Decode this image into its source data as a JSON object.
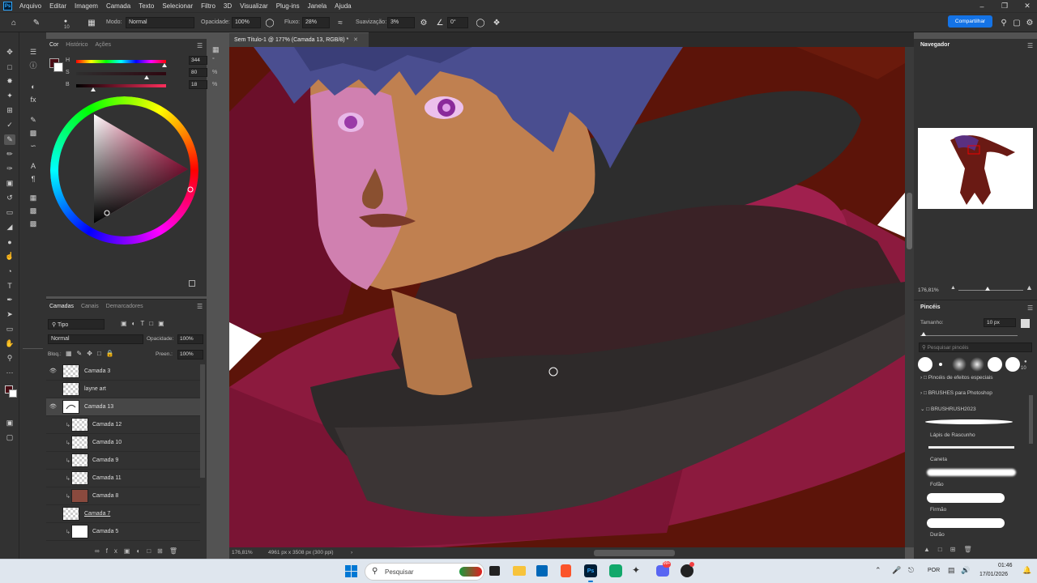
{
  "menu": [
    "Arquivo",
    "Editar",
    "Imagem",
    "Camada",
    "Texto",
    "Selecionar",
    "Filtro",
    "3D",
    "Visualizar",
    "Plug-ins",
    "Janela",
    "Ajuda"
  ],
  "options": {
    "brush_size": "10",
    "mode_label": "Modo:",
    "mode_value": "Normal",
    "opacity_label": "Opacidade:",
    "opacity_value": "100%",
    "flow_label": "Fluxo:",
    "flow_value": "28%",
    "smoothing_label": "Suavização:",
    "smoothing_value": "3%",
    "angle_value": "0°",
    "share_label": "Compartilhar"
  },
  "document_tab": "Sem Título-1 @ 177% (Camada 13, RGB/8) *",
  "color_panel": {
    "tabs": [
      "Cor",
      "Histórico",
      "Ações"
    ],
    "h_label": "H",
    "h_value": "344",
    "h_unit": "°",
    "s_label": "S",
    "s_value": "80",
    "s_unit": "%",
    "b_label": "B",
    "b_value": "18",
    "b_unit": "%",
    "foreground": "#4a0c14",
    "background": "#ffffff"
  },
  "layers_panel": {
    "tabs": [
      "Camadas",
      "Canais",
      "Demarcadores"
    ],
    "filter_kind": "Tipo",
    "blend_mode": "Normal",
    "opacity_label": "Opacidade:",
    "opacity_value": "100%",
    "lock_label": "Bloq.:",
    "fill_label": "Preen.:",
    "fill_value": "100%",
    "layers": [
      {
        "name": "Camada 3",
        "visible": true
      },
      {
        "name": "layne art",
        "visible": false
      },
      {
        "name": "Camada 13",
        "visible": true,
        "selected": true
      },
      {
        "name": "Camada 12",
        "visible": false,
        "clipped": true
      },
      {
        "name": "Camada 10",
        "visible": false,
        "clipped": true
      },
      {
        "name": "Camada 9",
        "visible": false,
        "clipped": true
      },
      {
        "name": "Camada 11",
        "visible": false,
        "clipped": true
      },
      {
        "name": "Camada 8",
        "visible": false,
        "clipped": true
      },
      {
        "name": "Camada 7",
        "visible": false
      },
      {
        "name": "Camada 5",
        "visible": false,
        "clipped": true
      }
    ]
  },
  "status": {
    "zoom": "176,81%",
    "doc_size": "4961 px x 3508 px (300 ppi)"
  },
  "navigator": {
    "title": "Navegador",
    "zoom": "176,81%"
  },
  "brushes": {
    "title": "Pincéis",
    "size_label": "Tamanho:",
    "size_value": "10 px",
    "search_placeholder": "Pesquisar pincéis",
    "preset_count": "10",
    "folders": [
      "Pincéis de efeitos especiais",
      "BRUSHES para Photoshop",
      "BRUSHRUSH2023"
    ],
    "items": [
      "Lápis de Rascunho",
      "Caneta",
      "Fofão",
      "Firmão",
      "Durão"
    ]
  },
  "taskbar": {
    "search_placeholder": "Pesquisar",
    "language": "POR",
    "time": "01:46",
    "date": "17/01/2026",
    "discord_badge": "99+"
  }
}
